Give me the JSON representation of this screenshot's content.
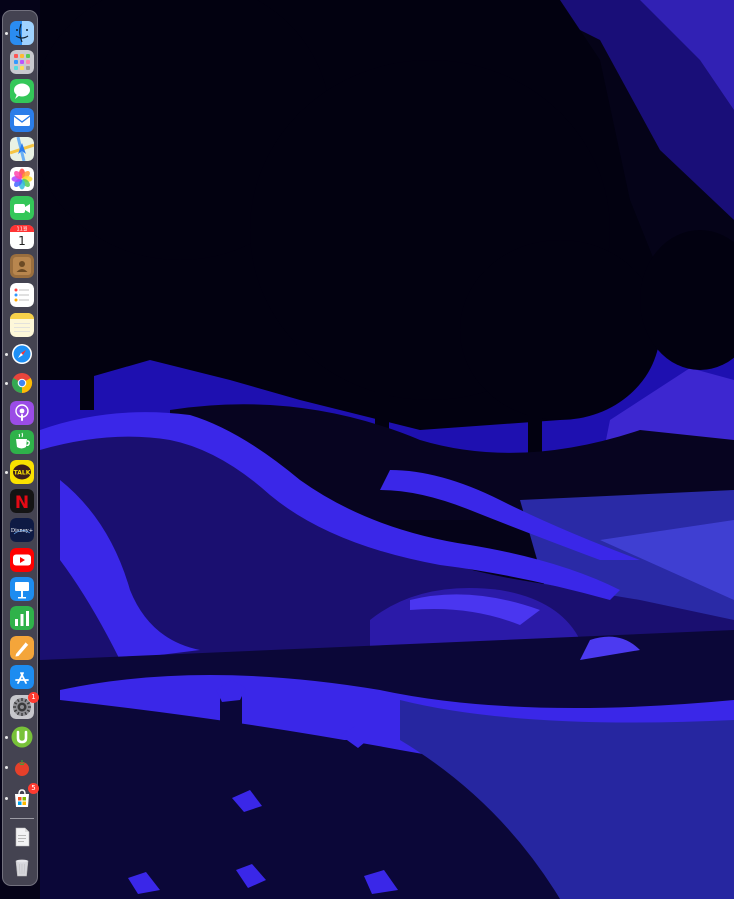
{
  "screen": {
    "wallpaper": "dark blue stylized night landscape with trees, rocks and water",
    "palette": {
      "sky": "#1e10b0",
      "rock_light": "#3a27e8",
      "rock_mid": "#24168a",
      "rock_dark": "#0e0840",
      "foliage": "#030214",
      "water": "#2a2aa6"
    }
  },
  "dock": {
    "position": "left",
    "apps": [
      {
        "id": "finder",
        "name": "Finder",
        "icon": "finder-icon",
        "running": true
      },
      {
        "id": "launchpad",
        "name": "Launchpad",
        "icon": "launchpad-icon",
        "running": false
      },
      {
        "id": "messages",
        "name": "Messages",
        "icon": "messages-icon",
        "running": false
      },
      {
        "id": "mail",
        "name": "Mail",
        "icon": "mail-icon",
        "running": false
      },
      {
        "id": "maps",
        "name": "Maps",
        "icon": "maps-icon",
        "running": false
      },
      {
        "id": "photos",
        "name": "Photos",
        "icon": "photos-icon",
        "running": false
      },
      {
        "id": "facetime",
        "name": "FaceTime",
        "icon": "facetime-icon",
        "running": false
      },
      {
        "id": "calendar",
        "name": "Calendar",
        "icon": "calendar-icon",
        "running": false,
        "month": "11월",
        "day": "1"
      },
      {
        "id": "contacts",
        "name": "Contacts",
        "icon": "contacts-icon",
        "running": false
      },
      {
        "id": "reminders",
        "name": "Reminders",
        "icon": "reminders-icon",
        "running": false
      },
      {
        "id": "notes",
        "name": "Notes",
        "icon": "notes-icon",
        "running": false
      },
      {
        "id": "safari",
        "name": "Safari",
        "icon": "safari-compass-icon",
        "running": true
      },
      {
        "id": "chrome",
        "name": "Google Chrome",
        "icon": "chrome-icon",
        "running": true
      },
      {
        "id": "podcasts",
        "name": "Podcasts",
        "icon": "podcasts-icon",
        "running": false
      },
      {
        "id": "caffeine",
        "name": "Cup",
        "icon": "coffee-cup-icon",
        "running": false
      },
      {
        "id": "kakaotalk",
        "name": "KakaoTalk",
        "icon": "kakaotalk-icon",
        "running": true,
        "label": "TALK"
      },
      {
        "id": "netflix",
        "name": "Netflix",
        "icon": "netflix-icon",
        "running": false,
        "label": "N"
      },
      {
        "id": "disneyplus",
        "name": "Disney+",
        "icon": "disney-plus-icon",
        "running": false,
        "label": "Disney+"
      },
      {
        "id": "youtube",
        "name": "YouTube",
        "icon": "youtube-icon",
        "running": false
      },
      {
        "id": "keynote",
        "name": "Keynote",
        "icon": "keynote-icon",
        "running": false
      },
      {
        "id": "numbers",
        "name": "Numbers",
        "icon": "numbers-chart-icon",
        "running": false
      },
      {
        "id": "pages",
        "name": "Pages",
        "icon": "pages-pen-icon",
        "running": false
      },
      {
        "id": "appstore",
        "name": "App Store",
        "icon": "app-store-icon",
        "running": false
      },
      {
        "id": "settings",
        "name": "System Preferences",
        "icon": "gear-icon",
        "running": false,
        "badge": "1"
      },
      {
        "id": "utorrent",
        "name": "uTorrent",
        "icon": "utorrent-icon",
        "running": true
      },
      {
        "id": "tomato",
        "name": "Tomato Timer",
        "icon": "tomato-icon",
        "running": true
      },
      {
        "id": "msstore",
        "name": "Microsoft Store",
        "icon": "microsoft-bag-icon",
        "running": true,
        "badge": "5"
      }
    ],
    "stack": [
      {
        "id": "documents",
        "name": "Documents",
        "icon": "document-stack-icon"
      },
      {
        "id": "trash",
        "name": "Trash",
        "icon": "trash-icon"
      }
    ]
  }
}
